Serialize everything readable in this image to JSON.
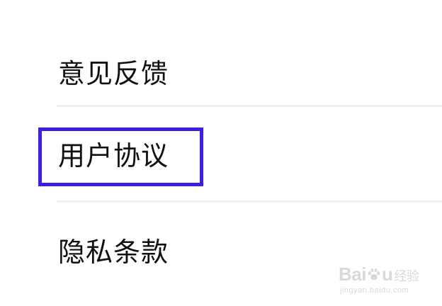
{
  "settings": {
    "items": [
      {
        "label": "意见反馈"
      },
      {
        "label": "用户协议"
      },
      {
        "label": "隐私条款"
      }
    ],
    "highlighted_item": "用户协议"
  },
  "watermark": {
    "brand_left": "Bai",
    "brand_right": "u",
    "suffix": "经验",
    "domain": "jingyan.baidu.com"
  },
  "colors": {
    "highlight": "#3d1fe0",
    "divider": "#eeeff1",
    "text": "#111111",
    "watermark": "#d9d9d9"
  }
}
